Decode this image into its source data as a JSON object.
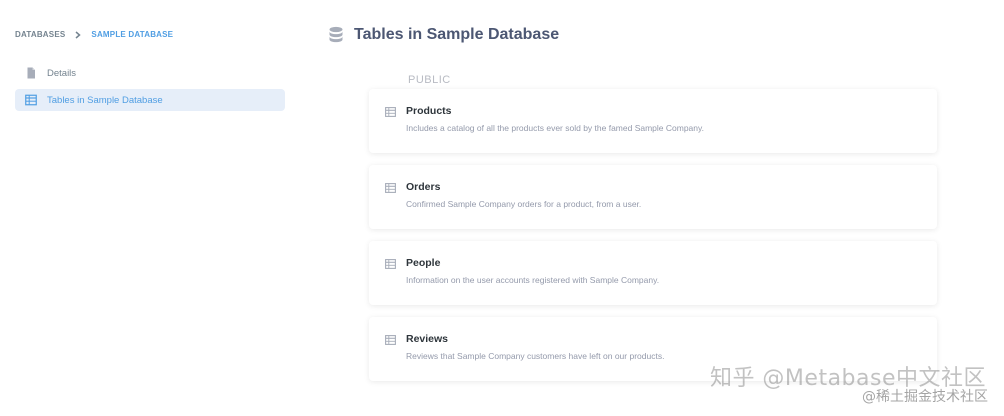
{
  "breadcrumb": {
    "root": "DATABASES",
    "current": "SAMPLE DATABASE"
  },
  "sidebar": {
    "items": [
      {
        "label": "Details",
        "icon": "document-icon",
        "active": false
      },
      {
        "label": "Tables in Sample Database",
        "icon": "table-icon",
        "active": true
      }
    ]
  },
  "header": {
    "title": "Tables in Sample Database",
    "icon": "database-icon"
  },
  "schema": "PUBLIC",
  "tables": [
    {
      "name": "Products",
      "description": "Includes a catalog of all the products ever sold by the famed Sample Company."
    },
    {
      "name": "Orders",
      "description": "Confirmed Sample Company orders for a product, from a user."
    },
    {
      "name": "People",
      "description": "Information on the user accounts registered with Sample Company."
    },
    {
      "name": "Reviews",
      "description": "Reviews that Sample Company customers have left on our products."
    }
  ],
  "watermark": {
    "line1": "知乎 @Metabase中文社区",
    "line2": "@稀土掘金技术社区"
  },
  "colors": {
    "accent": "#509ee3",
    "active_bg": "#e6eef9",
    "text_dark": "#2e353b",
    "text_muted": "#949aab"
  }
}
